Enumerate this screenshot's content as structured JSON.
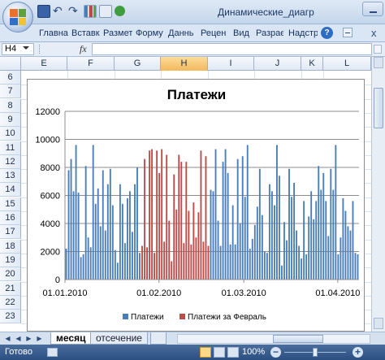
{
  "titlebar": {
    "title": "Динамические_диагр",
    "quick_access_icons": [
      "save-icon",
      "undo-icon",
      "redo-icon",
      "chart-icon",
      "print-icon"
    ]
  },
  "ribbon": {
    "tabs": [
      "Главна",
      "Вставк",
      "Размет",
      "Форму",
      "Даннь",
      "Рецен",
      "Вид",
      "Разрає",
      "Надстр"
    ],
    "help_glyph": "?",
    "close_glyph": "x"
  },
  "formula_bar": {
    "name_box": "H4",
    "fx_label": "fx",
    "value": ""
  },
  "grid": {
    "columns": [
      "E",
      "F",
      "G",
      "H",
      "I",
      "J",
      "K",
      "L"
    ],
    "selected_column": "H",
    "rows": [
      "6",
      "7",
      "8",
      "9",
      "10",
      "11",
      "12",
      "13",
      "14",
      "15",
      "16",
      "17",
      "18",
      "19",
      "20",
      "21",
      "22",
      "23"
    ]
  },
  "chart_data": {
    "type": "bar",
    "title": "Платежи",
    "xlabel": "",
    "ylabel": "",
    "ylim": [
      0,
      12000
    ],
    "yticks": [
      "0",
      "2000",
      "4000",
      "6000",
      "8000",
      "10000",
      "12000"
    ],
    "xticks": [
      "01.01.2010",
      "01.02.2010",
      "01.03.2010",
      "01.04.2010"
    ],
    "legend": [
      "Платежи",
      "Платежи за Февраль"
    ],
    "legend_position": "bottom",
    "grid": "horizontal",
    "colors": {
      "series1": "#4a7ebb",
      "series2": "#be4b48"
    },
    "x_start": "01.01.2010",
    "x_end": "08.04.2010",
    "series": [
      {
        "name": "Платежи",
        "values": [
          2200,
          7800,
          8600,
          6300,
          9600,
          6200,
          1600,
          1800,
          8100,
          3000,
          2300,
          9600,
          5400,
          6500,
          3800,
          7800,
          3500,
          6800,
          7900,
          5300,
          2100,
          1200,
          6800,
          5400,
          2600,
          5800,
          6300,
          3400,
          6800,
          8000,
          1900,
          0,
          0,
          0,
          0,
          0,
          0,
          0,
          0,
          0,
          0,
          0,
          0,
          0,
          0,
          0,
          0,
          0,
          0,
          0,
          0,
          0,
          0,
          0,
          0,
          0,
          0,
          0,
          0,
          6400,
          6300,
          9300,
          4200,
          2400,
          8400,
          9300,
          7600,
          2500,
          5300,
          2500,
          8600,
          4000,
          8800,
          5900,
          9600,
          2200,
          2900,
          3900,
          5200,
          7900,
          4600,
          2000,
          1900,
          6800,
          6300,
          5300,
          9600,
          7400,
          1000,
          4100,
          2800,
          7900,
          5900,
          6900,
          3500,
          2400,
          1500,
          5600,
          1800,
          4500,
          6300,
          4300,
          5600,
          8100,
          6400,
          7600,
          5600,
          3100,
          7900,
          6400,
          9600,
          1800,
          3000,
          5800,
          4900,
          3800,
          3500,
          5600,
          1900,
          1800
        ]
      },
      {
        "name": "Платежи за Февраль",
        "values": [
          0,
          0,
          0,
          0,
          0,
          0,
          0,
          0,
          0,
          0,
          0,
          0,
          0,
          0,
          0,
          0,
          0,
          0,
          0,
          0,
          0,
          0,
          0,
          0,
          0,
          0,
          0,
          0,
          0,
          0,
          0,
          2400,
          8600,
          2300,
          9200,
          9300,
          1900,
          9200,
          7600,
          9300,
          2700,
          8900,
          4200,
          1300,
          7500,
          5000,
          8900,
          8400,
          2600,
          8400,
          4900,
          2500,
          5500,
          3000,
          4800,
          9200,
          2700,
          8800,
          2400
        ]
      }
    ]
  },
  "sheets": {
    "active": "месяц",
    "inactive": "отсечение"
  },
  "statusbar": {
    "status": "Готово",
    "zoom": "100%",
    "zoom_level": 1.0
  }
}
